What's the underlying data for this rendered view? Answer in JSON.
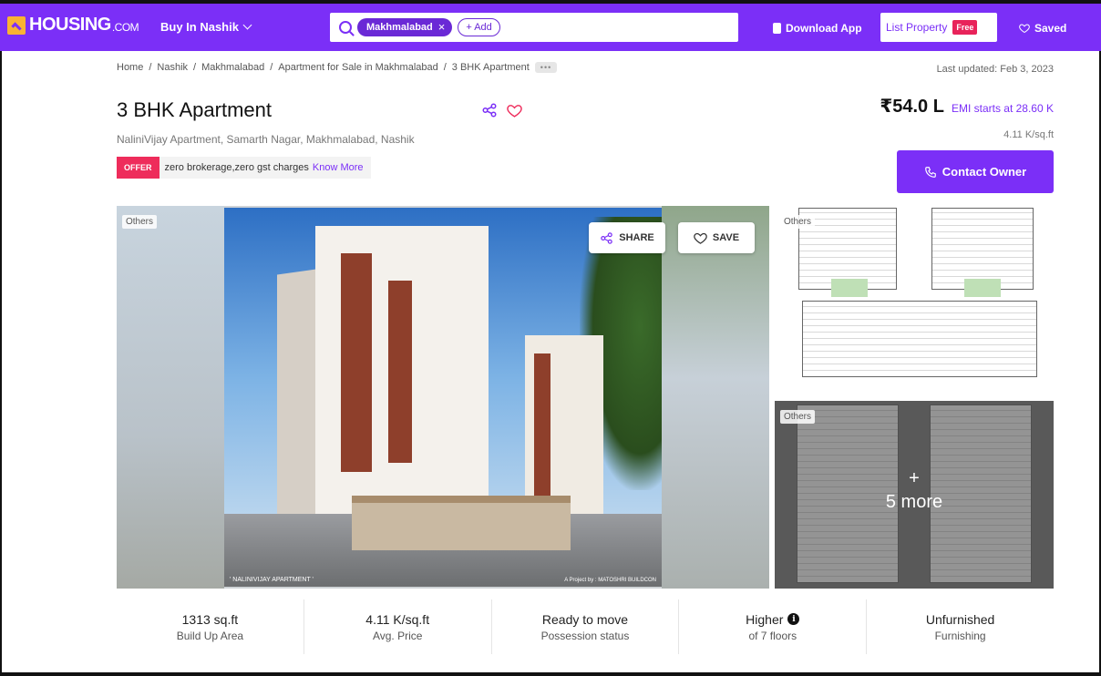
{
  "nav": {
    "logo_main": "HOUSING",
    "logo_suffix": ".COM",
    "buy_in": "Buy In Nashik",
    "search_chip": "Makhmalabad",
    "add_chip": "+ Add",
    "download_app": "Download App",
    "list_property": "List Property",
    "free_badge": "Free",
    "saved": "Saved"
  },
  "breadcrumb": {
    "items": [
      "Home",
      "Nashik",
      "Makhmalabad",
      "Apartment for Sale in Makhmalabad",
      "3 BHK Apartment"
    ],
    "separator": "/",
    "more": "•••"
  },
  "last_updated": "Last updated: Feb 3, 2023",
  "listing": {
    "title": "3 BHK Apartment",
    "address": "NaliniVijay Apartment, Samarth Nagar, Makhmalabad, Nashik",
    "offer_badge": "OFFER",
    "offer_text": "zero brokerage,zero gst charges",
    "offer_link": "Know More",
    "price": "₹54.0 L",
    "emi": "EMI starts at  28.60 K",
    "per_sqft": "4.11 K/sq.ft",
    "contact_button": "Contact Owner"
  },
  "gallery": {
    "main_tag": "Others",
    "share_label": "SHARE",
    "save_label": "SAVE",
    "caption_left": "' NALINIVIJAY APARTMENT '",
    "caption_right": "A Project by : MATOSHRI BUILDCON",
    "thumb1_tag": "Others",
    "thumb2_tag": "Others",
    "more_plus": "+",
    "more_label": "5 more"
  },
  "stats": [
    {
      "value": "1313 sq.ft",
      "label": "Build Up Area"
    },
    {
      "value": "4.11 K/sq.ft",
      "label": "Avg. Price"
    },
    {
      "value": "Ready to move",
      "label": "Possession status"
    },
    {
      "value": "Higher",
      "label": "of 7 floors",
      "info": true
    },
    {
      "value": "Unfurnished",
      "label": "Furnishing"
    }
  ],
  "colors": {
    "brand": "#7b2ff7",
    "offer": "#ee2c5b",
    "logo_accent": "#f9b233"
  }
}
